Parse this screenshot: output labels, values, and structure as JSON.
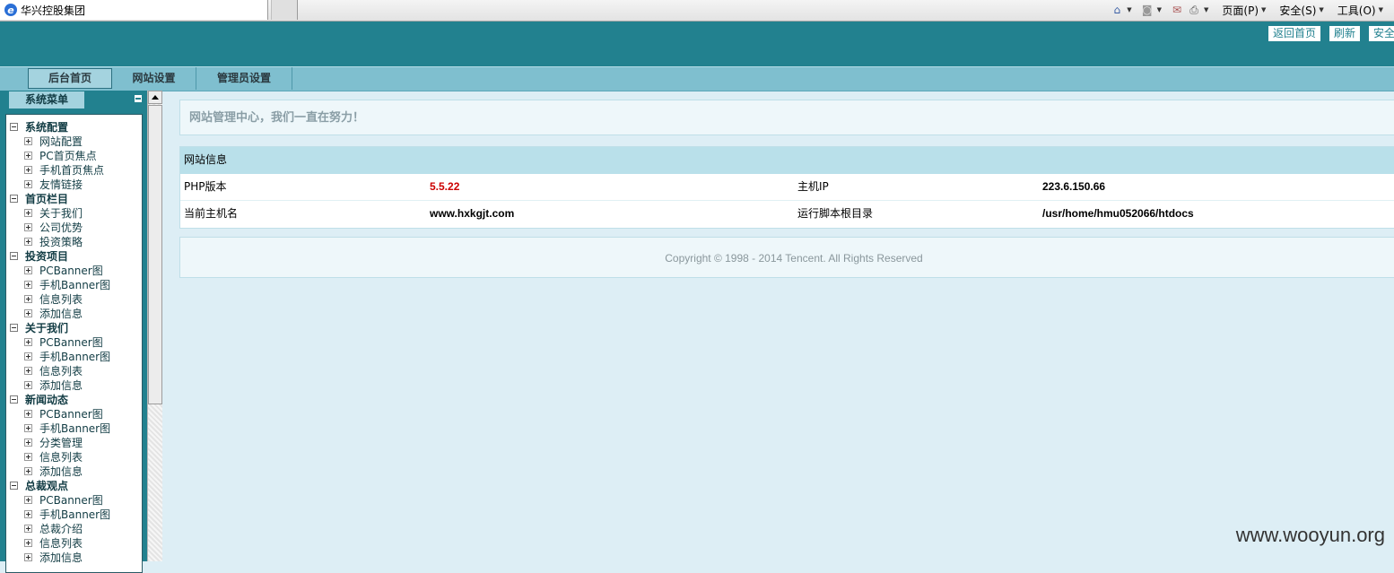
{
  "browser": {
    "tab_title": "华兴控股集团",
    "menu_page": "页面(P)",
    "menu_safety": "安全(S)",
    "menu_tools": "工具(O)"
  },
  "header": {
    "links": [
      "返回首页",
      "刷新",
      "安全退出"
    ]
  },
  "tabs": [
    "后台首页",
    "网站设置",
    "管理员设置"
  ],
  "sidebar": {
    "title": "系统菜单",
    "groups": [
      {
        "label": "系统配置",
        "items": [
          "网站配置",
          "PC首页焦点",
          "手机首页焦点",
          "友情链接"
        ]
      },
      {
        "label": "首页栏目",
        "items": [
          "关于我们",
          "公司优势",
          "投资策略"
        ]
      },
      {
        "label": "投资项目",
        "items": [
          "PCBanner图",
          "手机Banner图",
          "信息列表",
          "添加信息"
        ]
      },
      {
        "label": "关于我们",
        "items": [
          "PCBanner图",
          "手机Banner图",
          "信息列表",
          "添加信息"
        ]
      },
      {
        "label": "新闻动态",
        "items": [
          "PCBanner图",
          "手机Banner图",
          "分类管理",
          "信息列表",
          "添加信息"
        ]
      },
      {
        "label": "总裁观点",
        "items": [
          "PCBanner图",
          "手机Banner图",
          "总裁介绍",
          "信息列表",
          "添加信息"
        ]
      }
    ]
  },
  "main": {
    "welcome": "网站管理中心，我们一直在努力！",
    "info_title": "网站信息",
    "rows": [
      {
        "label1": "PHP版本",
        "value1": "5.5.22",
        "label2": "主机IP",
        "value2": "223.6.150.66"
      },
      {
        "label1": "当前主机名",
        "value1": "www.hxkgjt.com",
        "label2": "运行脚本根目录",
        "value2": "/usr/home/hmu052066/htdocs"
      }
    ],
    "copyright": "Copyright © 1998 - 2014 Tencent. All Rights Reserved"
  },
  "watermark": "www.wooyun.org"
}
